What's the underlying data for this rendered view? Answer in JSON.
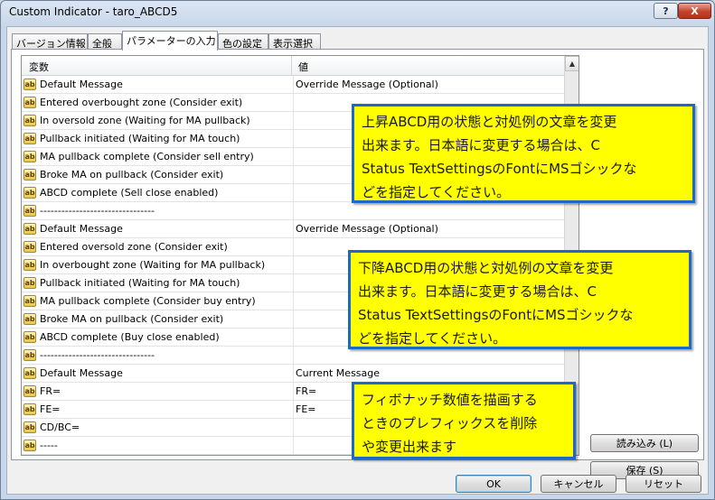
{
  "window": {
    "title": "Custom Indicator - taro_ABCD5",
    "help_label": "?",
    "close_label": "X"
  },
  "tabs": [
    {
      "label": "バージョン情報"
    },
    {
      "label": "全般"
    },
    {
      "label": "パラメーターの入力",
      "active": true
    },
    {
      "label": "色の設定"
    },
    {
      "label": "表示選択"
    }
  ],
  "grid": {
    "header_name": "変数",
    "header_value": "値",
    "icon_text": "ab",
    "rows": [
      {
        "name": "Default Message",
        "value": "Override Message (Optional)"
      },
      {
        "name": "Entered overbought zone (Consider exit)",
        "value": ""
      },
      {
        "name": "In oversold zone (Waiting for MA pullback)",
        "value": ""
      },
      {
        "name": "Pullback initiated (Waiting for MA touch)",
        "value": ""
      },
      {
        "name": "MA pullback complete (Consider sell entry)",
        "value": ""
      },
      {
        "name": "Broke MA on pullback (Consider exit)",
        "value": ""
      },
      {
        "name": "ABCD complete (Sell close enabled)",
        "value": ""
      },
      {
        "name": "--------------------------------",
        "value": ""
      },
      {
        "name": "Default Message",
        "value": "Override Message (Optional)"
      },
      {
        "name": "Entered oversold zone (Consider exit)",
        "value": ""
      },
      {
        "name": "In overbought zone (Waiting for MA pullback)",
        "value": ""
      },
      {
        "name": "Pullback initiated (Waiting for MA touch)",
        "value": ""
      },
      {
        "name": "MA pullback complete (Consider buy entry)",
        "value": ""
      },
      {
        "name": "Broke MA on pullback (Consider exit)",
        "value": ""
      },
      {
        "name": "ABCD complete (Buy close enabled)",
        "value": ""
      },
      {
        "name": "--------------------------------",
        "value": ""
      },
      {
        "name": "Default Message",
        "value": "Current Message"
      },
      {
        "name": "FR=",
        "value": "FR="
      },
      {
        "name": "FE=",
        "value": "FE="
      },
      {
        "name": "CD/BC=",
        "value": ""
      },
      {
        "name": "-----",
        "value": ""
      }
    ]
  },
  "side_buttons": {
    "load_label": "読み込み (L)",
    "save_label": "保存 (S)"
  },
  "footer_buttons": {
    "ok_label": "OK",
    "cancel_label": "キャンセル",
    "reset_label": "リセット"
  },
  "notes": {
    "up": "上昇ABCD用の状態と対処例の文章を変更\n出来ます。日本語に変更する場合は、C\nStatus TextSettingsのFontにMSゴシックな\nどを指定してください。",
    "down": "下降ABCD用の状態と対処例の文章を変更\n出来ます。日本語に変更する場合は、C\nStatus TextSettingsのFontにMSゴシックな\nどを指定してください。",
    "fibo": "フィボナッチ数値を描画する\nときのプレフィックスを削除\nや変更出来ます"
  },
  "colors": {
    "note_bg": "#ffff00",
    "note_border": "#1e69c8",
    "close_button": "#c3422b"
  }
}
